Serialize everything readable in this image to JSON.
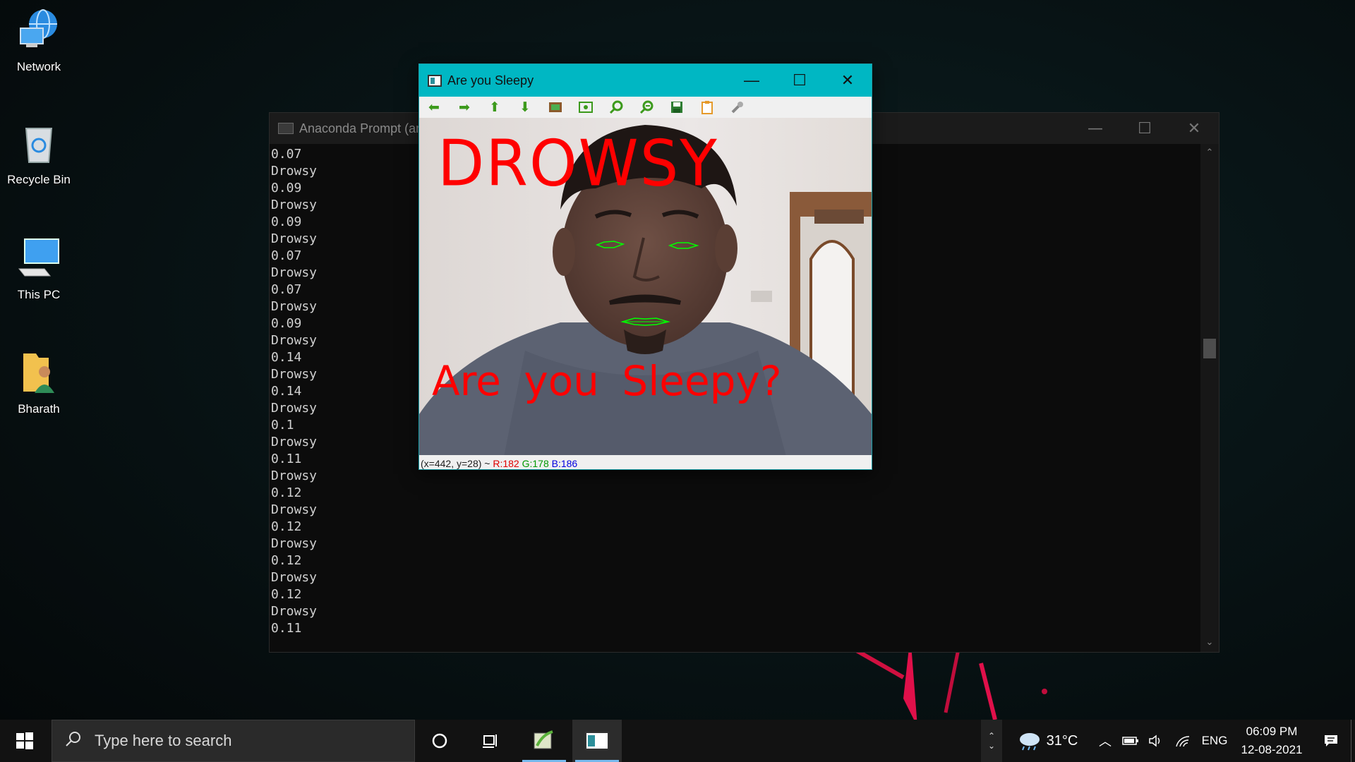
{
  "desktop": {
    "icons": [
      {
        "label": "Network",
        "icon": "network-icon"
      },
      {
        "label": "Recycle Bin",
        "icon": "recycle-bin-icon"
      },
      {
        "label": "This PC",
        "icon": "this-pc-icon"
      },
      {
        "label": "Bharath",
        "icon": "user-folder-icon"
      }
    ]
  },
  "console": {
    "title": "Anaconda Prompt (ar",
    "lines": [
      "0.07",
      "Drowsy",
      "0.09",
      "Drowsy",
      "0.09",
      "Drowsy",
      "0.07",
      "Drowsy",
      "0.07",
      "Drowsy",
      "0.09",
      "Drowsy",
      "0.14",
      "Drowsy",
      "0.14",
      "Drowsy",
      "0.1",
      "Drowsy",
      "0.11",
      "Drowsy",
      "0.12",
      "Drowsy",
      "0.12",
      "Drowsy",
      "0.12",
      "Drowsy",
      "0.12",
      "Drowsy",
      "0.11"
    ]
  },
  "cv_window": {
    "title": "Are you Sleepy",
    "toolbar_icons": [
      "pan-left-icon",
      "pan-right-icon",
      "pan-up-icon",
      "pan-down-icon",
      "zoom-original-icon",
      "zoom-fit-icon",
      "zoom-in-icon",
      "zoom-out-icon",
      "save-icon",
      "copy-icon",
      "properties-icon"
    ],
    "overlay_main": "DROWSY",
    "overlay_question": "Are you Sleepy?",
    "status": {
      "coords": "(x=442, y=28) ~",
      "r": "R:182",
      "g": "G:178",
      "b": "B:186"
    }
  },
  "taskbar": {
    "search_placeholder": "Type here to search",
    "weather": "31°C",
    "language": "ENG",
    "time": "06:09 PM",
    "date": "12-08-2021"
  },
  "colors": {
    "accent": "#00b7c3",
    "overlay_text": "#ff0000",
    "eye_contour": "#00ff00"
  }
}
